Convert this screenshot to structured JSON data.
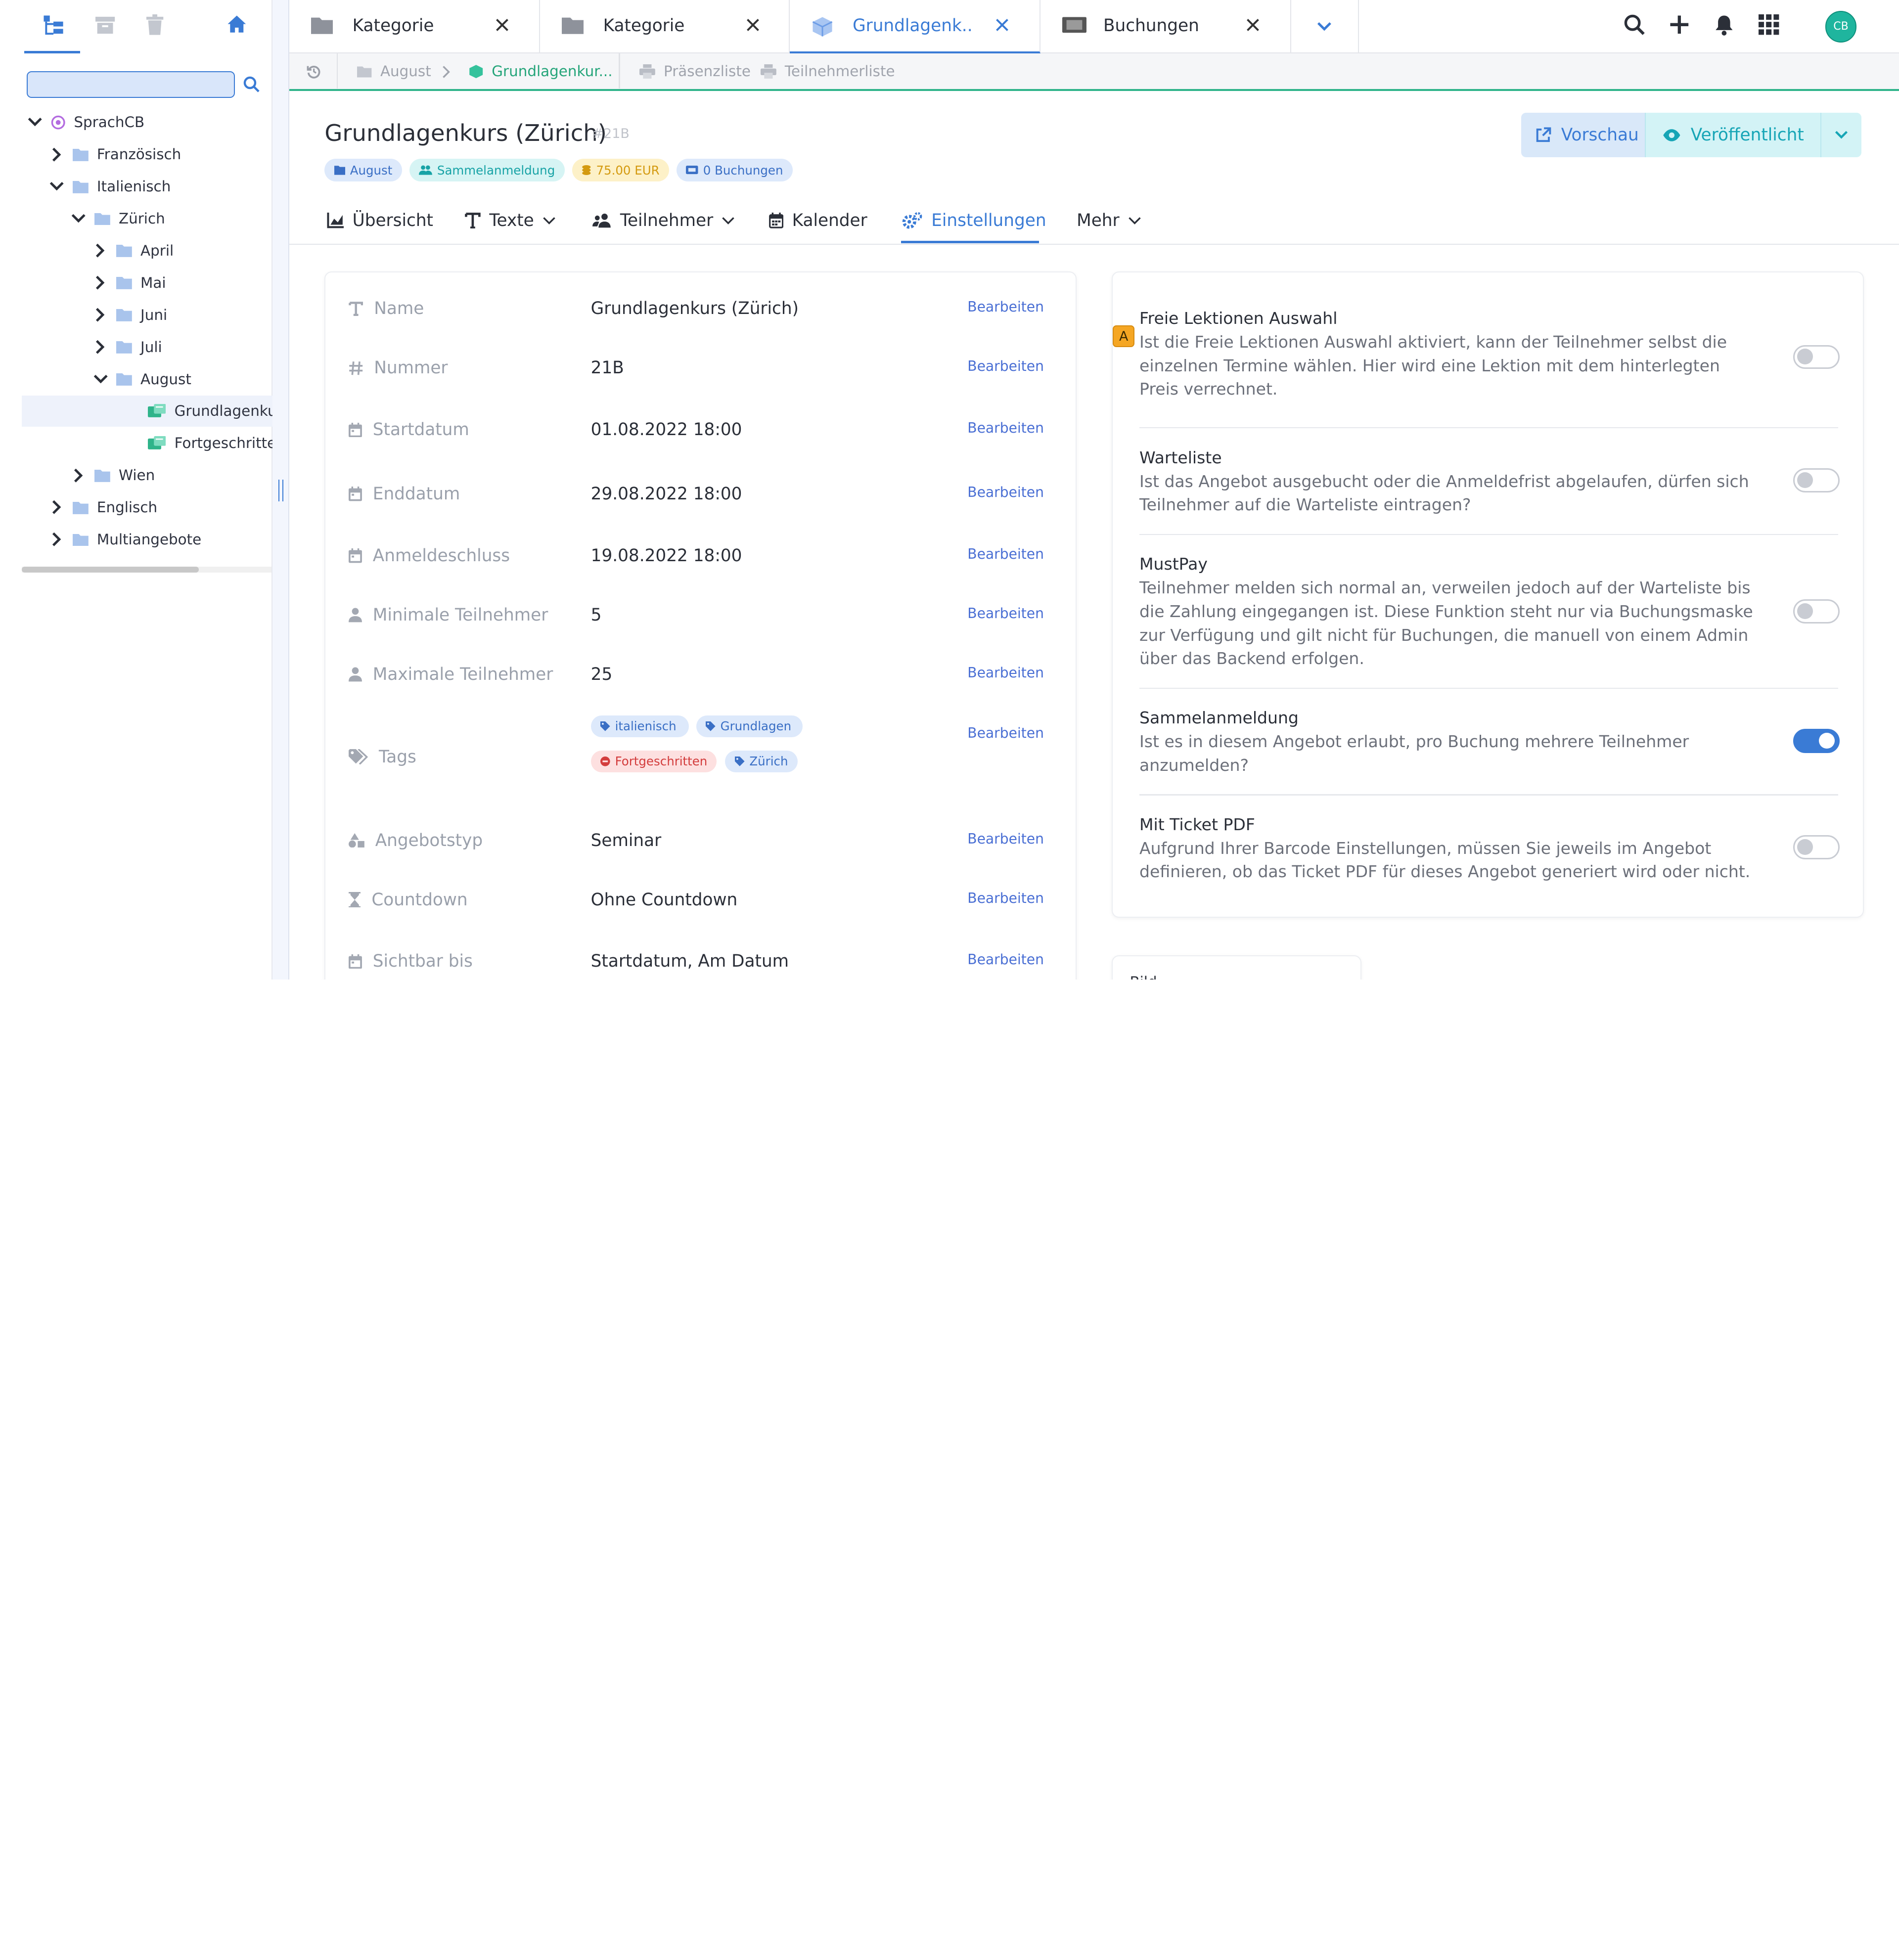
{
  "sidebar": {
    "toolbar_icons": [
      "tree-icon",
      "archive-icon",
      "trash-icon",
      "home-icon"
    ],
    "search": {
      "value": "",
      "placeholder": ""
    },
    "tree": [
      {
        "label": "SprachCB",
        "level": 0,
        "expanded": true,
        "kind": "root"
      },
      {
        "label": "Französisch",
        "level": 1,
        "expanded": false,
        "kind": "folder"
      },
      {
        "label": "Italienisch",
        "level": 1,
        "expanded": true,
        "kind": "folder"
      },
      {
        "label": "Zürich",
        "level": 2,
        "expanded": true,
        "kind": "folder"
      },
      {
        "label": "April",
        "level": 3,
        "expanded": false,
        "kind": "folder"
      },
      {
        "label": "Mai",
        "level": 3,
        "expanded": false,
        "kind": "folder"
      },
      {
        "label": "Juni",
        "level": 3,
        "expanded": false,
        "kind": "folder"
      },
      {
        "label": "Juli",
        "level": 3,
        "expanded": false,
        "kind": "folder"
      },
      {
        "label": "August",
        "level": 3,
        "expanded": true,
        "kind": "folder"
      },
      {
        "label": "Grundlagenkurs",
        "level": 4,
        "kind": "course",
        "selected": true
      },
      {
        "label": "Fortgeschrittene",
        "level": 4,
        "kind": "course"
      },
      {
        "label": "Wien",
        "level": 2,
        "expanded": false,
        "kind": "folder"
      },
      {
        "label": "Englisch",
        "level": 1,
        "expanded": false,
        "kind": "folder"
      },
      {
        "label": "Multiangebote",
        "level": 1,
        "expanded": false,
        "kind": "folder"
      }
    ]
  },
  "tabs": [
    {
      "label": "Kategorie",
      "icon": "folder-icon"
    },
    {
      "label": "Kategorie",
      "icon": "folder-icon"
    },
    {
      "label": "Grundlagenk...",
      "icon": "cube-icon",
      "active": true
    },
    {
      "label": "Buchungen",
      "icon": "ticket-icon"
    }
  ],
  "topbar_icons": [
    "search-icon",
    "plus-icon",
    "bell-icon",
    "apps-grid-icon"
  ],
  "user": {
    "initials": "CB"
  },
  "breadcrumb": {
    "items": [
      "August",
      "Grundlagenkur..."
    ],
    "lists": [
      "Präsenzliste",
      "Teilnehmerliste"
    ]
  },
  "page": {
    "title": "Grundlagenkurs (Zürich)",
    "number": "#21B",
    "badges": [
      {
        "label": "August",
        "style": "blue",
        "icon": "folder-icon"
      },
      {
        "label": "Sammelanmeldung",
        "style": "teal",
        "icon": "users-icon"
      },
      {
        "label": "75.00 EUR",
        "style": "yellow",
        "icon": "coins-icon"
      },
      {
        "label": "0 Buchungen",
        "style": "blue",
        "icon": "ticket-icon"
      }
    ],
    "buttons": {
      "preview": "Vorschau",
      "published": "Veröffentlicht"
    }
  },
  "subtabs": [
    {
      "label": "Übersicht",
      "icon": "chart-icon"
    },
    {
      "label": "Texte",
      "icon": "text-icon",
      "dropdown": true
    },
    {
      "label": "Teilnehmer",
      "icon": "participants-icon",
      "dropdown": true
    },
    {
      "label": "Kalender",
      "icon": "calendar-icon"
    },
    {
      "label": "Einstellungen",
      "icon": "cogs-icon",
      "active": true
    },
    {
      "label": "Mehr",
      "dropdown": true
    }
  ],
  "properties": {
    "edit_label": "Bearbeiten",
    "rows": [
      {
        "label": "Name",
        "value": "Grundlagenkurs (Zürich)",
        "icon": "text-icon"
      },
      {
        "label": "Nummer",
        "value": "21B",
        "icon": "hash-icon"
      },
      {
        "label": "Startdatum",
        "value": "01.08.2022 18:00",
        "icon": "calendar-icon"
      },
      {
        "label": "Enddatum",
        "value": "29.08.2022 18:00",
        "icon": "calendar-icon"
      },
      {
        "label": "Anmeldeschluss",
        "value": "19.08.2022 18:00",
        "icon": "calendar-icon"
      },
      {
        "label": "Minimale Teilnehmer",
        "value": "5",
        "icon": "user-icon"
      },
      {
        "label": "Maximale Teilnehmer",
        "value": "25",
        "icon": "user-icon"
      },
      {
        "label": "Tags",
        "value": "",
        "icon": "tags-icon"
      },
      {
        "label": "Angebotstyp",
        "value": "Seminar",
        "icon": "shapes-icon"
      },
      {
        "label": "Countdown",
        "value": "Ohne Countdown",
        "icon": "hourglass-icon"
      },
      {
        "label": "Sichtbar bis",
        "value": "Startdatum, Am Datum",
        "icon": "calendar-icon"
      }
    ],
    "tags": [
      {
        "label": "italienisch",
        "style": "blue",
        "icon": "tag-icon"
      },
      {
        "label": "Grundlagen",
        "style": "blue",
        "icon": "tag-icon"
      },
      {
        "label": "Fortgeschritten",
        "style": "red",
        "icon": "minus-circle-icon"
      },
      {
        "label": "Zürich",
        "style": "blue",
        "icon": "tag-icon"
      }
    ]
  },
  "settings": [
    {
      "title": "Freie Lektionen Auswahl",
      "desc": "Ist die Freie Lektionen Auswahl aktiviert, kann der Teilnehmer selbst die einzelnen Termine wählen. Hier wird eine Lektion mit dem hinterlegten Preis verrechnet.",
      "on": false,
      "marker": "A"
    },
    {
      "title": "Warteliste",
      "desc": "Ist das Angebot ausgebucht oder die Anmeldefrist abgelaufen, dürfen sich Teilnehmer auf die Warteliste eintragen?",
      "on": false
    },
    {
      "title": "MustPay",
      "desc": "Teilnehmer melden sich normal an, verweilen jedoch auf der Warteliste bis die Zahlung eingegangen ist. Diese Funktion steht nur via Buchungsmaske zur Verfügung und gilt nicht für Buchungen, die manuell von einem Admin über das Backend erfolgen.",
      "on": false
    },
    {
      "title": "Sammelanmeldung",
      "desc": "Ist es in diesem Angebot erlaubt, pro Buchung mehrere Teilnehmer anzumelden?",
      "on": true
    },
    {
      "title": "Mit Ticket PDF",
      "desc": "Aufgrund Ihrer Barcode Einstellungen, müssen Sie jeweils im Angebot definieren, ob das Ticket PDF für dieses Angebot generiert wird oder nicht.",
      "on": false
    }
  ],
  "bild_card": {
    "label": "Bild"
  },
  "colors": {
    "accent": "#3a7bd5",
    "green": "#2fb48a",
    "teal": "#16a5b6"
  }
}
